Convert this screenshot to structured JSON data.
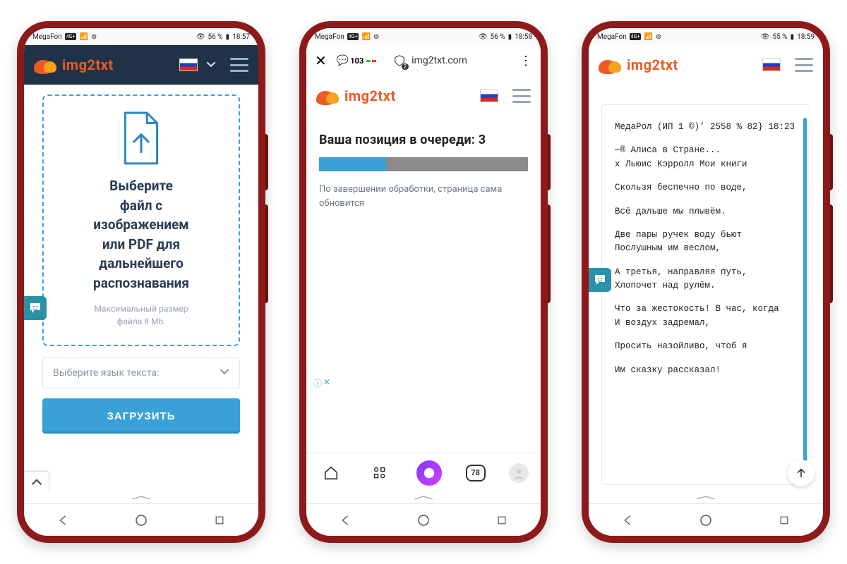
{
  "status": {
    "carrier": "MegaFon",
    "net": "4G+",
    "battery": "56 %",
    "battery3": "55 %",
    "time1": "18:57",
    "time2": "18:58",
    "time3": "18:59"
  },
  "brand": "img2txt",
  "phone1": {
    "upload_lines": [
      "Выберите",
      "файл с",
      "изображением",
      "или PDF для",
      "дальнейшего",
      "распознавания"
    ],
    "note_lines": [
      "Максимальный размер",
      "файла 8 Mb."
    ],
    "lang_placeholder": "Выберите язык текста:",
    "button": "ЗАГРУЗИТЬ"
  },
  "phone2": {
    "address": "img2txt.com",
    "msg_count": "103",
    "shield_badge": "2",
    "queue_title": "Ваша позиция в очереди: 3",
    "progress_pct": 32,
    "queue_note": "По завершении обработки, страница сама обновится",
    "tab_count": "78"
  },
  "phone3": {
    "lines": [
      "МедаРол (ИП 1 ©)' 2558 % 82} 18:23",
      "—® Алиса в Стране...\nх Льюис Кэрролл Мои книги",
      "Скользя беспечно по воде,",
      "Всё дальше мы плывём.",
      "Две пары ручек воду бьют\nПослушным им веслом,",
      "А третья, направляя путь,\nХлопочет над рулём.",
      "Что за жестокость! В час, когда\nИ воздух задремал,",
      "Просить назойливо, чтоб я",
      "Им сказку рассказал!"
    ]
  }
}
